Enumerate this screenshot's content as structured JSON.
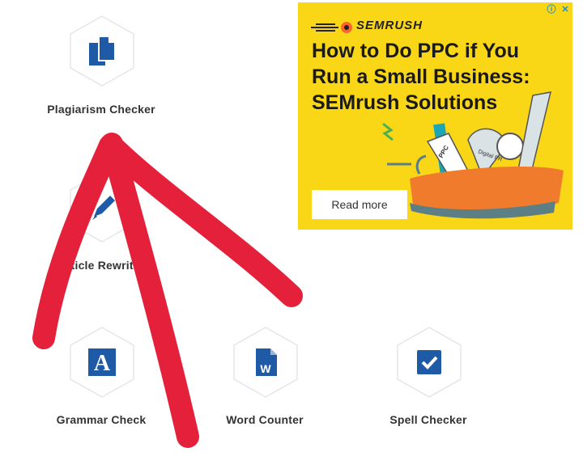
{
  "tools": [
    {
      "label": "Plagiarism Checker",
      "icon": "copy-documents-icon"
    },
    {
      "label": "Article Rewriter",
      "icon": "pencil-icon"
    },
    {
      "label": "Grammar Check",
      "icon": "letter-a-icon"
    },
    {
      "label": "Word Counter",
      "icon": "word-document-icon"
    },
    {
      "label": "Spell Checker",
      "icon": "checkbox-icon"
    }
  ],
  "ad": {
    "brand": "SEMRUSH",
    "headline": "How to Do PPC if You Run a Small Business: SEMrush Solutions",
    "cta": "Read more",
    "info_symbol": "ⓘ",
    "close_symbol": "✕",
    "knife_tags": [
      "PPC",
      "Digital PR"
    ],
    "colors": {
      "background": "#f9d616",
      "accent": "#ff642d"
    }
  },
  "colors": {
    "icon_blue": "#1f5aa6",
    "annotation_red": "#e4203a"
  }
}
